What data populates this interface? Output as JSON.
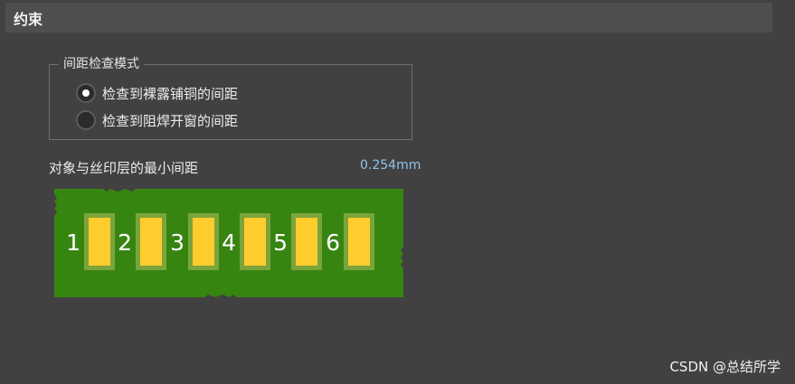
{
  "section": {
    "title": "约束"
  },
  "spacing_mode": {
    "legend": "间距检查模式",
    "options": [
      {
        "label": "检查到裸露铺铜的间距",
        "selected": true
      },
      {
        "label": "检查到阻焊开窗的间距",
        "selected": false
      }
    ]
  },
  "min_clearance": {
    "label": "对象与丝印层的最小间距",
    "value": "0.254mm"
  },
  "pcb": {
    "board_color": "#378511",
    "pad_color": "#ffcc2e",
    "pad_ring_color": "#7ba43a",
    "pads": [
      {
        "number": "1"
      },
      {
        "number": "2"
      },
      {
        "number": "3"
      },
      {
        "number": "4"
      },
      {
        "number": "5"
      },
      {
        "number": "6"
      }
    ]
  },
  "watermark": "CSDN @总结所学"
}
